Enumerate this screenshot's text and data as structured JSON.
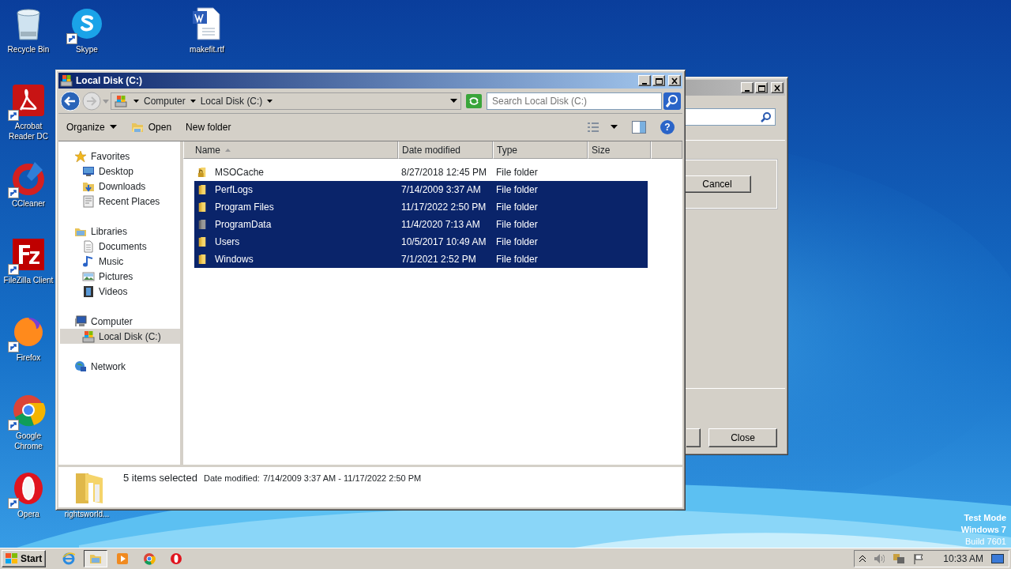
{
  "desktop_icons": [
    {
      "label": "Recycle Bin",
      "kind": "recycle-bin",
      "shortcut": false
    },
    {
      "label": "Skype",
      "kind": "skype",
      "shortcut": true
    },
    {
      "label": "makefit.rtf",
      "kind": "word-doc",
      "shortcut": false
    },
    {
      "label": "Acrobat Reader DC",
      "kind": "pdf",
      "shortcut": true
    },
    {
      "label": "CCleaner",
      "kind": "ccleaner",
      "shortcut": true
    },
    {
      "label": "FileZilla Client",
      "kind": "filezilla",
      "shortcut": true
    },
    {
      "label": "Firefox",
      "kind": "firefox",
      "shortcut": true
    },
    {
      "label": "Google Chrome",
      "kind": "chrome",
      "shortcut": true
    },
    {
      "label": "Opera",
      "kind": "opera",
      "shortcut": true
    },
    {
      "label": "rightsworld..."
    }
  ],
  "background_window": {
    "buttons": [
      "Cancel",
      "Close"
    ]
  },
  "explorer": {
    "title": "Local Disk (C:)",
    "breadcrumbs": [
      "Computer",
      "Local Disk (C:)"
    ],
    "search": {
      "placeholder": "Search Local Disk (C:)"
    },
    "help": "?",
    "toolbar": [
      {
        "label": "Organize",
        "kind": "menu"
      },
      {
        "label": "Open",
        "kind": "open"
      },
      {
        "label": "New folder",
        "kind": "plain"
      }
    ],
    "navigation": [
      {
        "label": "Favorites",
        "kind": "star",
        "selected": false,
        "children": [
          {
            "label": "Desktop",
            "kind": "desktop",
            "selected": false
          },
          {
            "label": "Downloads",
            "kind": "downloads",
            "selected": false
          },
          {
            "label": "Recent Places",
            "kind": "recent",
            "selected": false
          }
        ]
      },
      {
        "label": "Libraries",
        "kind": "library",
        "selected": false,
        "children": [
          {
            "label": "Documents",
            "kind": "document",
            "selected": false
          },
          {
            "label": "Music",
            "kind": "music",
            "selected": false
          },
          {
            "label": "Pictures",
            "kind": "pictures",
            "selected": false
          },
          {
            "label": "Videos",
            "kind": "videos",
            "selected": false
          }
        ]
      },
      {
        "label": "Computer",
        "kind": "computer",
        "selected": false,
        "children": [
          {
            "label": "Local Disk (C:)",
            "kind": "drive",
            "selected": true
          }
        ]
      },
      {
        "label": "Network",
        "kind": "network",
        "selected": false
      }
    ],
    "columns": [
      {
        "label": "Name",
        "sorted": true
      },
      {
        "label": "Date modified",
        "sorted": false
      },
      {
        "label": "Type",
        "sorted": false
      },
      {
        "label": "Size",
        "sorted": false
      }
    ],
    "rows": [
      {
        "name": "MSOCache",
        "date": "8/27/2018 12:45 PM",
        "type": "File folder",
        "kind": "locked",
        "selected": false
      },
      {
        "name": "PerfLogs",
        "date": "7/14/2009 3:37 AM",
        "type": "File folder",
        "kind": "folder",
        "selected": true
      },
      {
        "name": "Program Files",
        "date": "11/17/2022 2:50 PM",
        "type": "File folder",
        "kind": "folder",
        "selected": true
      },
      {
        "name": "ProgramData",
        "date": "11/4/2020 7:13 AM",
        "type": "File folder",
        "kind": "hidden",
        "selected": true
      },
      {
        "name": "Users",
        "date": "10/5/2017 10:49 AM",
        "type": "File folder",
        "kind": "folder",
        "selected": true
      },
      {
        "name": "Windows",
        "date": "7/1/2021 2:52 PM",
        "type": "File folder",
        "kind": "folder",
        "selected": true
      }
    ],
    "details": {
      "summary": "5 items selected",
      "label": "Date modified:",
      "value": "7/14/2009 3:37 AM - 11/17/2022 2:50 PM"
    }
  },
  "taskbar": {
    "start": "Start",
    "apps": [
      {
        "kind": "ie",
        "selected": false
      },
      {
        "kind": "explorer",
        "selected": true
      },
      {
        "kind": "media",
        "selected": false
      },
      {
        "kind": "chrome",
        "selected": false
      },
      {
        "kind": "opera",
        "selected": false
      }
    ],
    "clock": "10:33 AM"
  },
  "os_notice": [
    {
      "text": "Test Mode",
      "strong": true
    },
    {
      "text": "Windows 7",
      "strong": true
    },
    {
      "text": "Build 7601",
      "strong": false
    }
  ]
}
